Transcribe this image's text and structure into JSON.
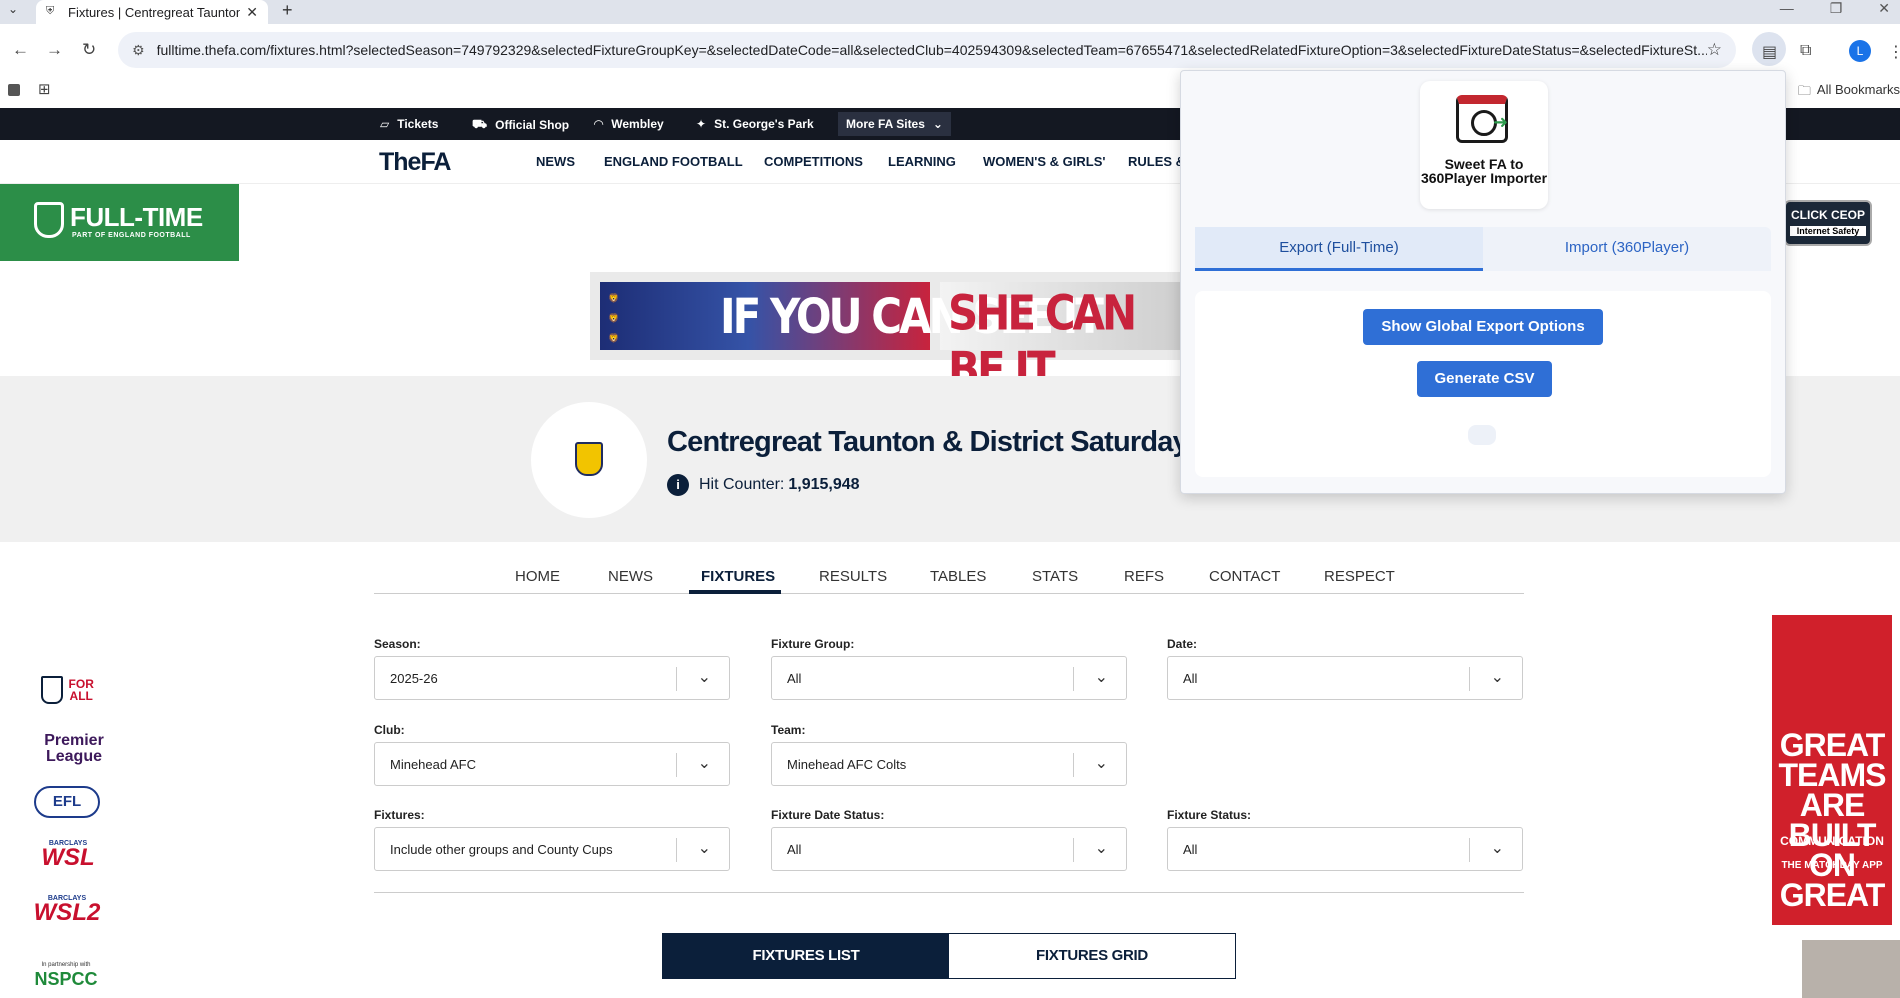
{
  "browser": {
    "tab_title": "Fixtures | Centregreat Taunton &",
    "url": "fulltime.thefa.com/fixtures.html?selectedSeason=749792329&selectedFixtureGroupKey=&selectedDateCode=all&selectedClub=402594309&selectedTeam=67655471&selectedRelatedFixtureOption=3&selectedFixtureDateStatus=&selectedFixtureSt...",
    "bookmarks_label": "All Bookmarks",
    "profile_initial": "L"
  },
  "fa_topbar": {
    "items": [
      "Tickets",
      "Official Shop",
      "Wembley",
      "St. George's Park"
    ],
    "more": "More FA Sites"
  },
  "fa_nav": {
    "logo": "TheFA",
    "links": [
      "NEWS",
      "ENGLAND FOOTBALL",
      "COMPETITIONS",
      "LEARNING",
      "WOMEN'S & GIRLS'",
      "RULES &"
    ]
  },
  "fulltime": {
    "logo_big": "FULL-TIME",
    "logo_small": "PART OF ENGLAND FOOTBALL",
    "ceop_top": "CLICK CEOP",
    "ceop_bottom": "Internet Safety"
  },
  "banner": {
    "text1": "IF YOU CAN SEE IT",
    "text2": "SHE CAN BE IT."
  },
  "league": {
    "title": "Centregreat Taunton & District Saturday Foot",
    "hit_label": "Hit Counter:",
    "hit_value": "1,915,948"
  },
  "subnav": {
    "items": [
      "HOME",
      "NEWS",
      "FIXTURES",
      "RESULTS",
      "TABLES",
      "STATS",
      "REFS",
      "CONTACT",
      "RESPECT"
    ],
    "active": "FIXTURES"
  },
  "filters": {
    "season": {
      "label": "Season:",
      "value": "2025-26"
    },
    "fixture_group": {
      "label": "Fixture Group:",
      "value": "All"
    },
    "date": {
      "label": "Date:",
      "value": "All"
    },
    "club": {
      "label": "Club:",
      "value": "Minehead AFC"
    },
    "team": {
      "label": "Team:",
      "value": "Minehead AFC Colts"
    },
    "fixtures": {
      "label": "Fixtures:",
      "value": "Include other groups and County Cups"
    },
    "fixture_date_status": {
      "label": "Fixture Date Status:",
      "value": "All"
    },
    "fixture_status": {
      "label": "Fixture Status:",
      "value": "All"
    }
  },
  "view_toggle": {
    "list": "FIXTURES LIST",
    "grid": "FIXTURES GRID"
  },
  "side_logos": {
    "for_all": "FOR ALL",
    "premier_league": "Premier League",
    "efl": "EFL",
    "barclays": "BARCLAYS",
    "wsl": "WSL",
    "wsl2": "WSL2",
    "nspcc_small": "In partnership with",
    "nspcc": "NSPCC"
  },
  "ad": {
    "headline": "GREAT TEAMS ARE BUILT ON GREAT",
    "sub": "COMMUNICATION",
    "app": "THE MATCHDAY APP"
  },
  "extension": {
    "name": "Sweet FA to 360Player Importer",
    "tab_export": "Export (Full-Time)",
    "tab_import": "Import (360Player)",
    "btn_global": "Show Global Export Options",
    "btn_csv": "Generate CSV"
  },
  "colors": {
    "fa_navy": "#0b1f3a",
    "fulltime_green": "#2c8e48",
    "ext_blue": "#2f6fd6",
    "ad_red": "#d0202b"
  }
}
